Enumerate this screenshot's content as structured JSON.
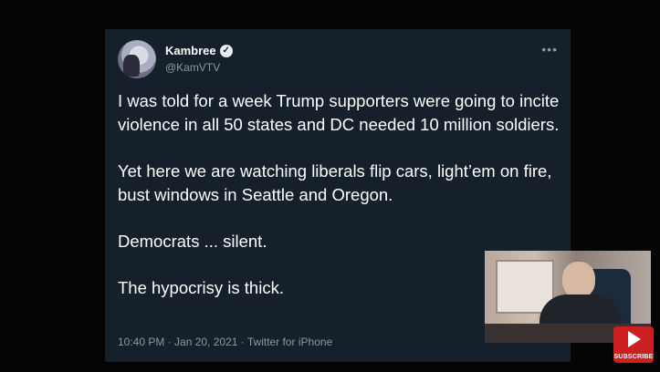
{
  "tweet": {
    "author_name": "Kambree",
    "handle": "@KamVTV",
    "paragraphs": [
      "I was told for a week Trump supporters were going to incite violence in all 50 states and DC needed 10 million soldiers.",
      "Yet here we are watching liberals flip cars, light’em on fire, bust windows in Seattle and Oregon.",
      "Democrats ... silent.",
      "The hypocrisy is thick."
    ],
    "meta": "10:40 PM · Jan 20, 2021 · Twitter for iPhone",
    "more_icon": "•••",
    "verified_icon": "✓"
  },
  "overlay": {
    "subscribe_label": "SUBSCRIBE"
  },
  "colors": {
    "card_background": "#15202b",
    "text_primary": "#ffffff",
    "text_secondary": "#8899a6",
    "subscribe_red": "#cc1f1f"
  }
}
